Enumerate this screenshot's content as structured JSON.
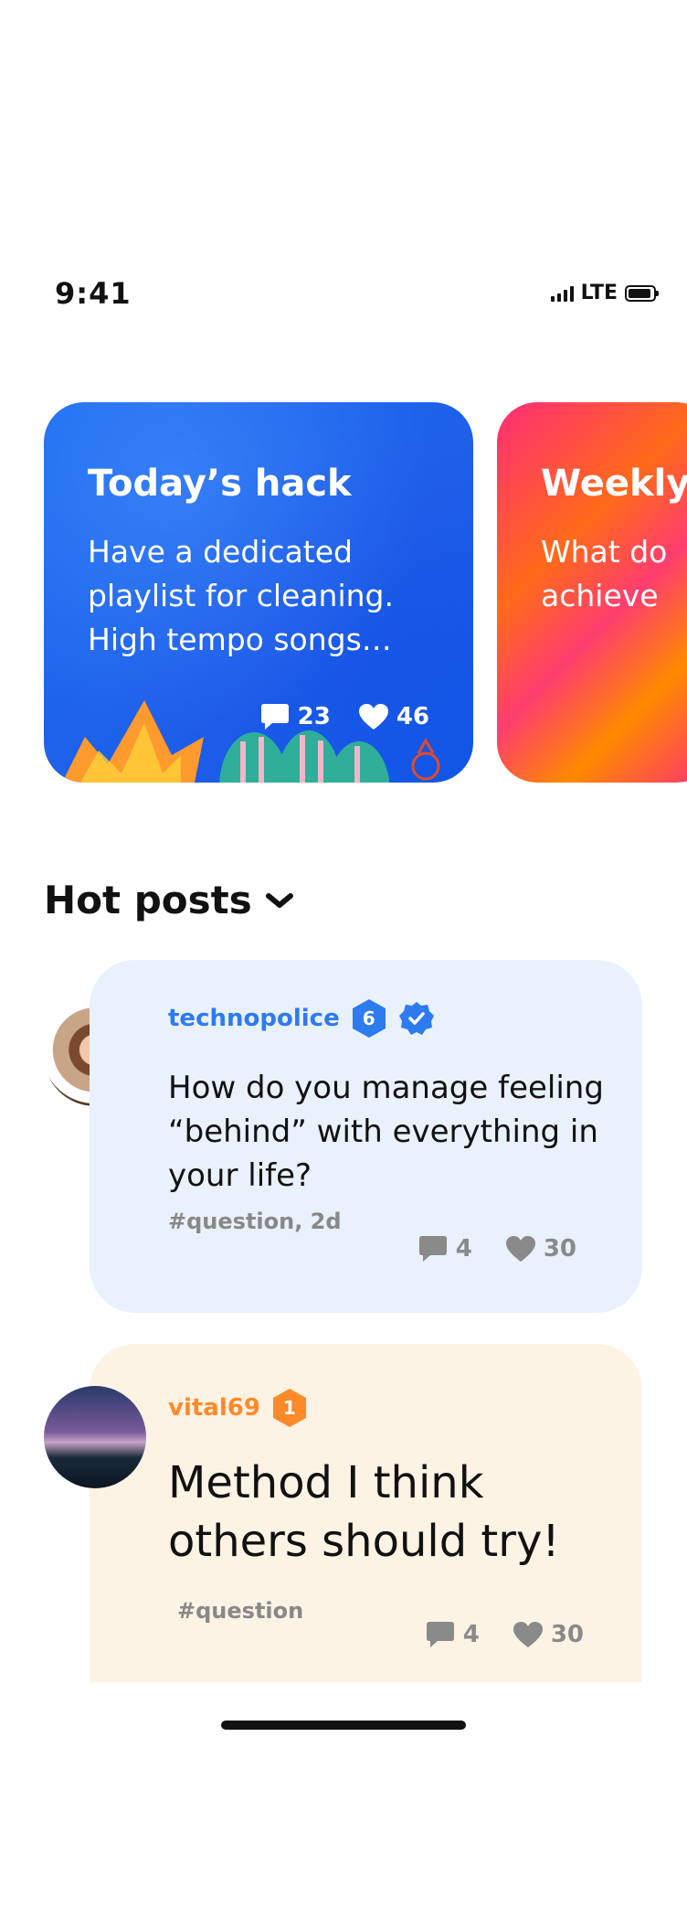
{
  "status_bar": {
    "time": "9:41",
    "network": "LTE"
  },
  "hack_cards": [
    {
      "title": "Today’s hack",
      "body": "Have a dedicated playlist for cleaning. High tempo songs…",
      "comments": "23",
      "likes": "46"
    },
    {
      "title": "Weekly",
      "body": "What do\nachieve"
    }
  ],
  "hot_posts": {
    "title": "Hot posts",
    "posts": [
      {
        "username": "technopolice",
        "level": "6",
        "verified": true,
        "text": "How do you manage feeling “behind” with everything in your life?",
        "tags": "#question, 2d",
        "comments": "4",
        "likes": "30"
      },
      {
        "username": "vital69",
        "level": "1",
        "verified": false,
        "text": "Method I think others should try!",
        "tags": "#question",
        "comments": "4",
        "likes": "30"
      }
    ]
  },
  "colors": {
    "blue_accent": "#2e7bf0",
    "orange_accent": "#ff8a2a",
    "post1_bg": "#e9f1fd",
    "post2_bg": "#fdf3e4"
  }
}
